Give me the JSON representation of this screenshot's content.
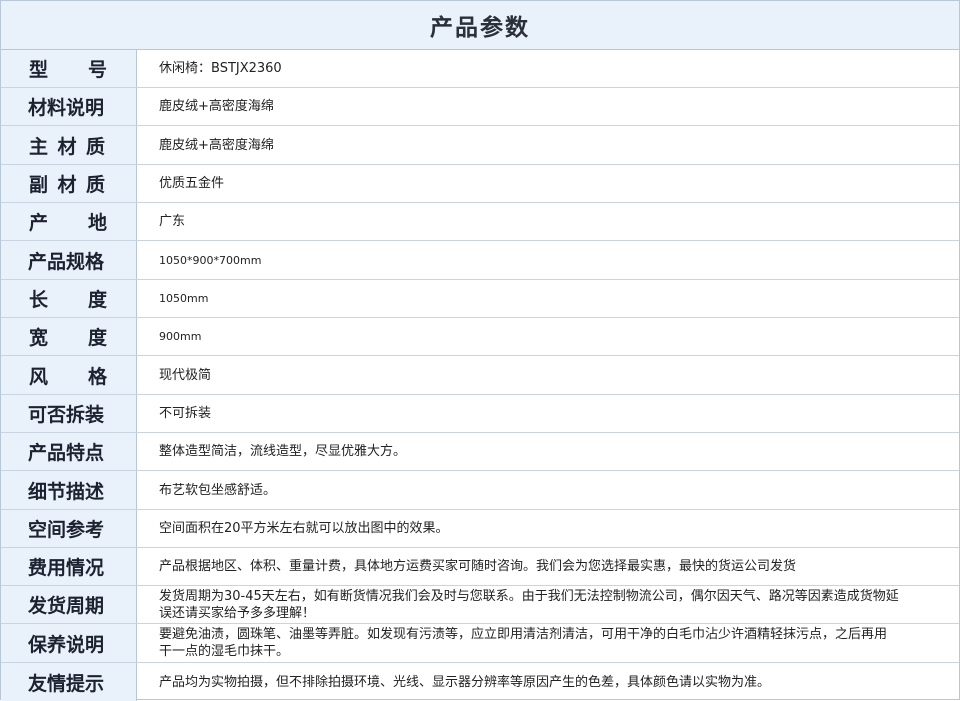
{
  "title": "产品参数",
  "rows": [
    {
      "label": "型号",
      "value": "休闲椅：BSTJX2360"
    },
    {
      "label": "材料说明",
      "value": "鹿皮绒+高密度海绵"
    },
    {
      "label": "主材质",
      "value": "鹿皮绒+高密度海绵"
    },
    {
      "label": "副材质",
      "value": "优质五金件"
    },
    {
      "label": "产地",
      "value": "广东"
    },
    {
      "label": "产品规格",
      "value": "1050*900*700mm"
    },
    {
      "label": "长度",
      "value": "1050mm"
    },
    {
      "label": "宽度",
      "value": "900mm"
    },
    {
      "label": "风格",
      "value": "现代极简"
    },
    {
      "label": "可否拆装",
      "value": "不可拆装"
    },
    {
      "label": "产品特点",
      "value": "整体造型简洁，流线造型，尽显优雅大方。"
    },
    {
      "label": "细节描述",
      "value": "布艺软包坐感舒适。"
    },
    {
      "label": "空间参考",
      "value": "空间面积在20平方米左右就可以放出图中的效果。"
    },
    {
      "label": "费用情况",
      "value": "产品根据地区、体积、重量计费，具体地方运费买家可随时咨询。我们会为您选择最实惠，最快的货运公司发货"
    },
    {
      "label": "发货周期",
      "value": "发货周期为30-45天左右，如有断货情况我们会及时与您联系。由于我们无法控制物流公司，偶尔因天气、路况等因素造成货物延误还请买家给予多多理解！"
    },
    {
      "label": "保养说明",
      "value": "要避免油渍，圆珠笔、油墨等弄脏。如发现有污渍等，应立即用清洁剂清洁，可用干净的白毛巾沾少许酒精轻抹污点，之后再用干一点的湿毛巾抹干。"
    },
    {
      "label": "友情提示",
      "value": "产品均为实物拍摄，但不排除拍摄环境、光线、显示器分辨率等原因产生的色差，具体颜色请以实物为准。"
    }
  ]
}
